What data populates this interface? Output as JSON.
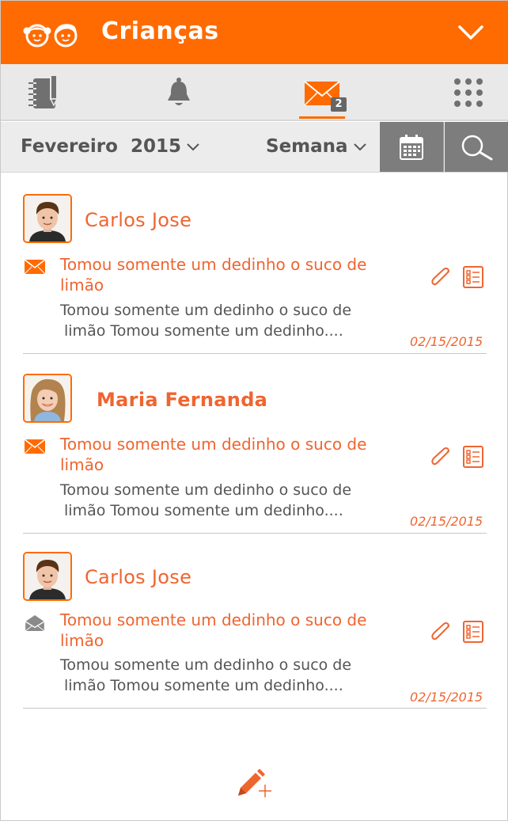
{
  "header": {
    "title": "Crianças",
    "logo_icon": "two-kids-faces-icon",
    "menu_icon": "chevron-down-icon",
    "brand_color": "#ff6b00"
  },
  "tabs": [
    {
      "name": "notebook",
      "icon": "notebook-pen-icon",
      "active": false
    },
    {
      "name": "notifications",
      "icon": "bell-icon",
      "active": false
    },
    {
      "name": "messages",
      "icon": "envelope-icon",
      "active": true,
      "badge": "2"
    },
    {
      "name": "apps",
      "icon": "grid-dots-icon",
      "active": false
    }
  ],
  "filters": {
    "month": "Fevereiro",
    "year": "2015",
    "period": "Semana",
    "calendar_icon": "calendar-icon",
    "search_icon": "search-icon"
  },
  "messages": [
    {
      "sender": "Carlos Jose",
      "avatar": "boy-avatar",
      "status_icon": "envelope-unread-icon",
      "subject": "Tomou somente um dedinho o suco de limão",
      "body_line1": "Tomou somente um dedinho o suco de",
      "body_line2": "limão Tomou somente um dedinho....",
      "date": "02/15/2015",
      "has_attachment": true
    },
    {
      "sender": "Maria Fernanda",
      "avatar": "girl-avatar",
      "status_icon": "envelope-unread-icon",
      "subject": "Tomou somente um dedinho o suco de limão",
      "body_line1": "Tomou somente um dedinho o suco de",
      "body_line2": "limão Tomou somente um dedinho....",
      "date": "02/15/2015",
      "has_attachment": true
    },
    {
      "sender": "Carlos Jose",
      "avatar": "boy-avatar",
      "status_icon": "envelope-read-icon",
      "subject": "Tomou somente um dedinho o suco de limão",
      "body_line1": "Tomou somente um dedinho o suco de",
      "body_line2": "limão Tomou somente um dedinho....",
      "date": "02/15/2015",
      "has_attachment": true
    }
  ],
  "compose": {
    "icon": "pencil-plus-icon"
  }
}
